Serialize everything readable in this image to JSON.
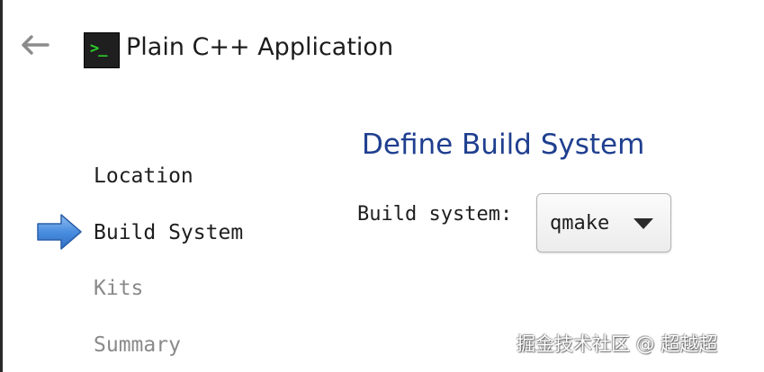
{
  "header": {
    "title": "Plain C++ Application",
    "app_icon": "terminal-icon",
    "app_icon_glyph": ">_",
    "back_icon": "back-arrow-icon"
  },
  "steps": [
    {
      "label": "Location",
      "state": "done"
    },
    {
      "label": "Build System",
      "state": "current"
    },
    {
      "label": "Kits",
      "state": "pending"
    },
    {
      "label": "Summary",
      "state": "pending"
    }
  ],
  "page": {
    "title": "Define Build System",
    "build_system_label": "Build system:",
    "build_system_value": "qmake"
  },
  "watermark": {
    "text": "掘金技术社区 @ 超越超"
  },
  "colors": {
    "page_title": "#1f3f8f",
    "current_arrow": "#4a8ee0",
    "pending_step": "#8a8a8a",
    "icon_prompt": "#2bd12b"
  }
}
